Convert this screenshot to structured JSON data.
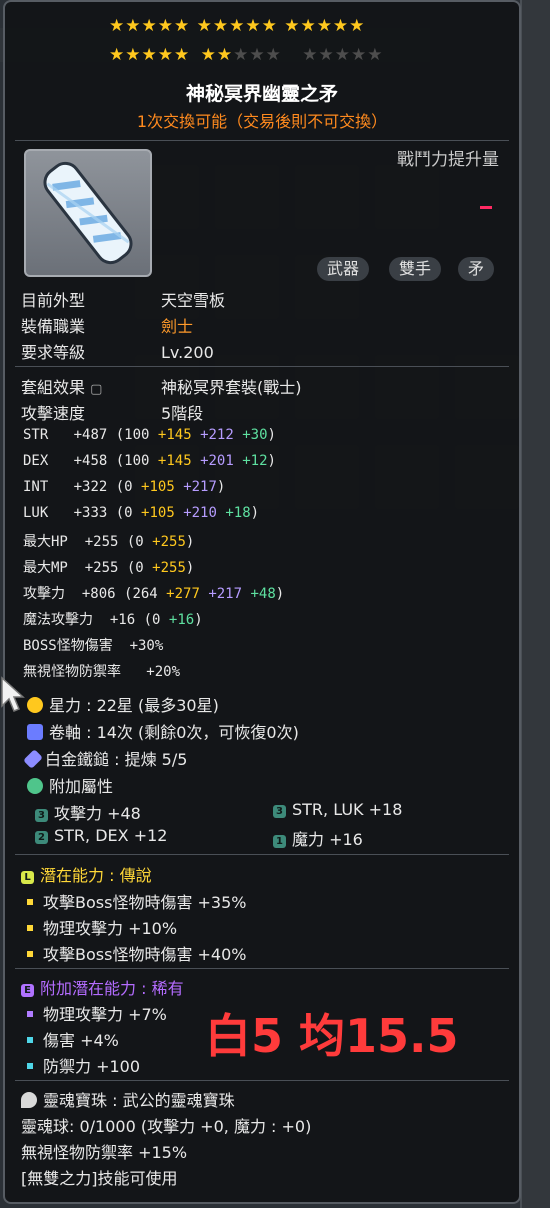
{
  "stars": {
    "row1": "★★★★★ ★★★★★ ★★★★★",
    "row2_on": [
      "★★★★★",
      "★★"
    ],
    "row2_off": [
      "★★★",
      "★★★★★"
    ]
  },
  "item": {
    "name": "神秘冥界幽靈之矛",
    "trade_note": "1次交換可能（交易後則不可交換）",
    "power_label": "戰鬥力提升量",
    "tags": [
      "武器",
      "雙手",
      "矛"
    ]
  },
  "info": [
    {
      "label": "目前外型",
      "value": "天空雪板",
      "color": "#e8e8e8"
    },
    {
      "label": "裝備職業",
      "value": "劍士",
      "color": "#ff8a1e"
    },
    {
      "label": "要求等級",
      "value": "Lv.200",
      "color": "#e8e8e8"
    }
  ],
  "set": {
    "label": "套組效果",
    "value": "神秘冥界套裝(戰士)"
  },
  "attack_speed": {
    "label": "攻擊速度",
    "value": "5階段"
  },
  "stats": [
    {
      "name": "STR",
      "total": "+487",
      "base": "(100",
      "star": "+145",
      "flame": "+212",
      "pot": "+30",
      "close": ")"
    },
    {
      "name": "DEX",
      "total": "+458",
      "base": "(100",
      "star": "+145",
      "flame": "+201",
      "pot": "+12",
      "close": ")"
    },
    {
      "name": "INT",
      "total": "+322",
      "base": "(0",
      "star": "+105",
      "flame": "+217",
      "pot": "",
      "close": ")"
    },
    {
      "name": "LUK",
      "total": "+333",
      "base": "(0",
      "star": "+105",
      "flame": "+210",
      "pot": "+18",
      "close": ")"
    },
    {
      "name": "最大HP",
      "total": "+255",
      "base": "(0",
      "star": "+255",
      "flame": "",
      "pot": "",
      "close": ")"
    },
    {
      "name": "最大MP",
      "total": "+255",
      "base": "(0",
      "star": "+255",
      "flame": "",
      "pot": "",
      "close": ")"
    },
    {
      "name": "攻擊力",
      "total": "+806",
      "base": "(264",
      "star": "+277",
      "flame": "+217",
      "pot": "+48",
      "close": ")"
    },
    {
      "name": "魔法攻擊力",
      "total": "+16",
      "base": "(0",
      "star": "",
      "flame": "",
      "pot": "+16",
      "close": ")"
    },
    {
      "name": "BOSS怪物傷害",
      "total": "+30%",
      "base": "",
      "star": "",
      "flame": "",
      "pot": "",
      "close": ""
    },
    {
      "name": "無視怪物防禦率",
      "total": "+20%",
      "base": "",
      "star": "",
      "flame": "",
      "pot": "",
      "close": ""
    }
  ],
  "upgrades": {
    "star": "星力 : 22星 (最多30星)",
    "scroll": "卷軸 : 14次 (剩餘0次，可恢復0次)",
    "hammer": "白金鐵鎚 : 提煉 5/5",
    "add_label": "附加屬性"
  },
  "extra_opts": [
    {
      "badge": "3",
      "text": "攻擊力 +48"
    },
    {
      "badge": "3",
      "text": "STR, LUK  +18"
    },
    {
      "badge": "2",
      "text": "STR, DEX  +12"
    },
    {
      "badge": "1",
      "text": "魔力 +16"
    }
  ],
  "potential": {
    "badge": "L",
    "label": "潛在能力",
    "grade": "傳說",
    "lines": [
      "攻擊Boss怪物時傷害 +35%",
      "物理攻擊力 +10%",
      "攻擊Boss怪物時傷害 +40%"
    ]
  },
  "additional_potential": {
    "badge": "E",
    "label": "附加潛在能力",
    "grade": "稀有",
    "lines": [
      "物理攻擊力 +7%",
      "傷害 +4%",
      "防禦力 +100"
    ]
  },
  "soul": {
    "gem": "靈魂寶珠 : 武公的靈魂寶珠",
    "orb": "靈魂球: 0/1000 (攻擊力 +0, 魔力 : +0)",
    "ignore": "無視怪物防禦率 +15%",
    "skill": "[無雙之力]技能可使用"
  },
  "overlay_note": "白5 均15.5"
}
